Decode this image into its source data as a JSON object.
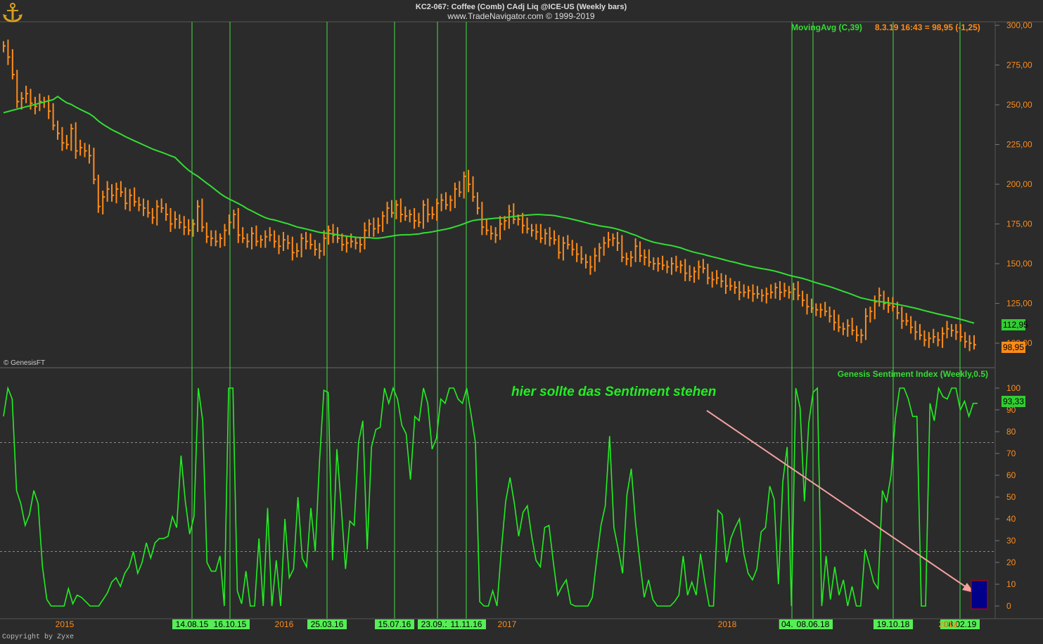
{
  "header": {
    "title": "KC2-067:  Coffee (Comb) CAdj Liq @ICE-US  (Weekly bars)",
    "subtitle": "www.TradeNavigator.com © 1999-2019",
    "genesis_mark": "© GenesisFT",
    "copyright": "Copyright by Zyxe",
    "logo": "anchor-logo"
  },
  "annotation": {
    "text": "hier sollte das Sentiment stehen"
  },
  "colors": {
    "background": "#2b2b2b",
    "price_bars": "#ff8c1a",
    "moving_avg": "#33dd33",
    "sentiment": "#22ee22",
    "vlines": "#44dd44",
    "axis_text": "#ff8c1a",
    "arrow": "#f4a0a0",
    "marker_fill": "#00008b",
    "marker_border": "#cc0000"
  },
  "chart_data": [
    {
      "type": "bar",
      "name": "price",
      "legend": "MovingAvg (C,39)",
      "readout": "8.3.19 16:43 = 98,95 (-1,25)",
      "ylim": [
        87,
        305
      ],
      "yticks": [
        300,
        275,
        250,
        225,
        200,
        175,
        150,
        125,
        100
      ],
      "ytick_labels": [
        "300,00",
        "275,00",
        "250,00",
        "225,00",
        "200,00",
        "175,00",
        "150,00",
        "125,00",
        "100,00"
      ],
      "last_ma_label": "112,95",
      "last_price_label": "98,95",
      "x_range": [
        0,
        220
      ],
      "ohlc_close": [
        287,
        280,
        269,
        252,
        254,
        257,
        251,
        249,
        252,
        252,
        246,
        237,
        232,
        226,
        225,
        235,
        221,
        223,
        221,
        218,
        203,
        186,
        192,
        197,
        193,
        197,
        195,
        188,
        193,
        189,
        187,
        185,
        182,
        179,
        186,
        185,
        181,
        175,
        178,
        176,
        173,
        171,
        175,
        186,
        173,
        167,
        166,
        164,
        166,
        171,
        176,
        181,
        168,
        166,
        164,
        169,
        164,
        165,
        167,
        168,
        164,
        161,
        165,
        163,
        157,
        158,
        166,
        164,
        162,
        159,
        158,
        166,
        171,
        168,
        166,
        162,
        163,
        164,
        163,
        162,
        171,
        175,
        172,
        174,
        180,
        185,
        182,
        187,
        181,
        180,
        181,
        177,
        176,
        187,
        181,
        181,
        188,
        190,
        187,
        190,
        197,
        195,
        205,
        200,
        192,
        185,
        173,
        171,
        169,
        168,
        175,
        177,
        183,
        178,
        178,
        174,
        172,
        171,
        170,
        166,
        169,
        166,
        165,
        157,
        163,
        162,
        159,
        156,
        153,
        151,
        148,
        155,
        160,
        163,
        165,
        166,
        163,
        154,
        153,
        154,
        161,
        155,
        154,
        151,
        150,
        150,
        149,
        148,
        150,
        148,
        149,
        144,
        142,
        145,
        148,
        147,
        141,
        140,
        141,
        139,
        136,
        136,
        135,
        132,
        132,
        133,
        131,
        131,
        130,
        131,
        132,
        135,
        132,
        133,
        132,
        134,
        130,
        127,
        123,
        122,
        121,
        121,
        120,
        117,
        113,
        110,
        109,
        111,
        108,
        105,
        105,
        117,
        120,
        126,
        130,
        125,
        124,
        123,
        119,
        114,
        114,
        110,
        107,
        105,
        102,
        103,
        104,
        102,
        106,
        109,
        108,
        107,
        104,
        101,
        100,
        99
      ]
    },
    {
      "type": "line",
      "name": "sentiment",
      "legend": "Genesis Sentiment Index (Weekly,0.5)",
      "ylim": [
        -5,
        106
      ],
      "yticks": [
        100,
        90,
        80,
        70,
        60,
        50,
        40,
        30,
        20,
        10,
        0
      ],
      "last_label": "93,33",
      "dashed_levels": [
        75,
        25
      ],
      "values": [
        87,
        100,
        95,
        53,
        47,
        37,
        42,
        53,
        47,
        18,
        3,
        0,
        0,
        0,
        0,
        8,
        1,
        5,
        4,
        2,
        0,
        0,
        0,
        3,
        6,
        11,
        13,
        9,
        15,
        18,
        25,
        15,
        20,
        29,
        22,
        29,
        31,
        31,
        32,
        41,
        36,
        69,
        48,
        33,
        41,
        100,
        85,
        20,
        16,
        16,
        23,
        0,
        100,
        100,
        7,
        1,
        16,
        0,
        0,
        31,
        0,
        45,
        0,
        21,
        0,
        40,
        13,
        17,
        50,
        22,
        18,
        45,
        25,
        67,
        99,
        98,
        21,
        72,
        46,
        17,
        39,
        37,
        75,
        85,
        26,
        73,
        81,
        82,
        100,
        93,
        100,
        95,
        83,
        79,
        58,
        87,
        85,
        100,
        93,
        72,
        77,
        95,
        93,
        100,
        100,
        95,
        93,
        100,
        88,
        75,
        2,
        0,
        0,
        7,
        0,
        26,
        48,
        59,
        47,
        32,
        43,
        46,
        32,
        21,
        18,
        36,
        37,
        20,
        5,
        9,
        12,
        1,
        0,
        0,
        0,
        0,
        4,
        21,
        37,
        46,
        78,
        36,
        26,
        15,
        51,
        63,
        38,
        20,
        4,
        12,
        3,
        0,
        0,
        0,
        0,
        2,
        5,
        23,
        5,
        11,
        5,
        24,
        11,
        0,
        0,
        44,
        42,
        20,
        31,
        36,
        40,
        24,
        15,
        12,
        17,
        34,
        36,
        55,
        49,
        10,
        57,
        73,
        0,
        100,
        91,
        48,
        84,
        98,
        100,
        0,
        23,
        3,
        18,
        5,
        12,
        0,
        9,
        0,
        0,
        26,
        19,
        11,
        8,
        53,
        48,
        60,
        86,
        100,
        100,
        95,
        87,
        87,
        0,
        0,
        93,
        85,
        100,
        96,
        95,
        100,
        100,
        90,
        94,
        87,
        93,
        93
      ],
      "vlines": [
        "14.08.15",
        "16.10.15",
        "25.03.16",
        "15.07.16",
        "23.09.16",
        "11.11.16",
        "04.05",
        "08.06.18",
        "19.10.18",
        "08.02.19"
      ],
      "year_labels": [
        "2015",
        "2016",
        "2017",
        "2018",
        "2019"
      ]
    }
  ]
}
